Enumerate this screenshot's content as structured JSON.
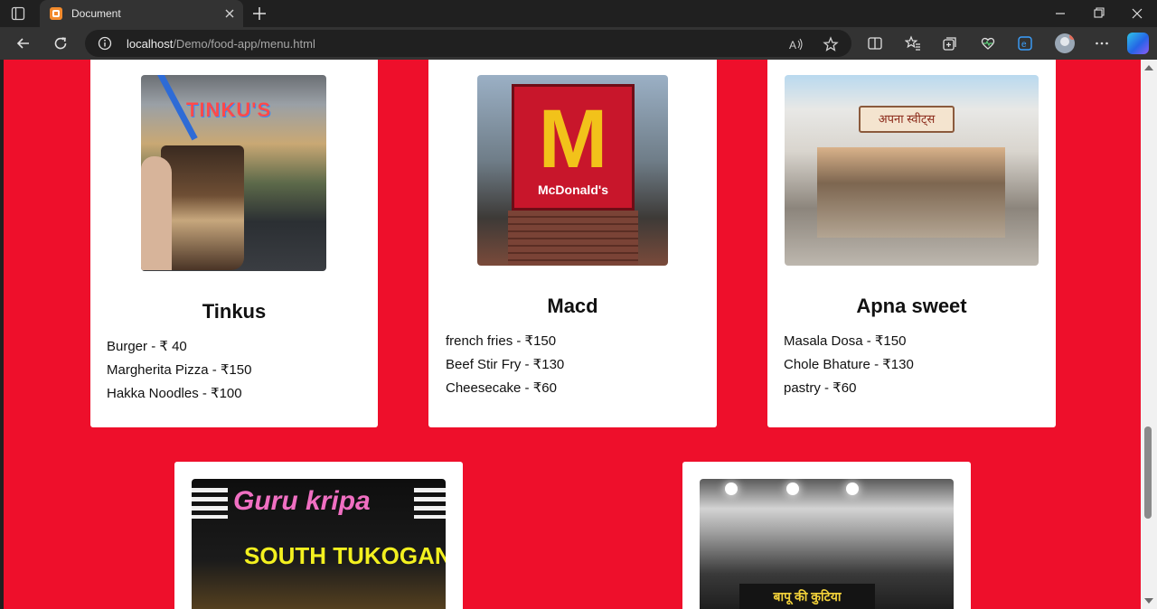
{
  "browser": {
    "tab_title": "Document",
    "url_host": "localhost",
    "url_path": "/Demo/food-app/menu.html"
  },
  "colors": {
    "page_background": "#ee0f2b",
    "card_background": "#ffffff"
  },
  "restaurants": [
    {
      "name": "Tinkus",
      "photo_sign": "TINKU'S",
      "menu": [
        "Burger - ₹ 40",
        "Margherita Pizza - ₹150",
        "Hakka Noodles - ₹100"
      ]
    },
    {
      "name": "Macd",
      "photo_sign": "McDonald's",
      "menu": [
        "french fries - ₹150",
        "Beef Stir Fry - ₹130",
        "Cheesecake - ₹60"
      ]
    },
    {
      "name": "Apna sweet",
      "photo_sign": "अपना स्वीट्स",
      "menu": [
        "Masala Dosa - ₹150",
        "Chole Bhature - ₹130",
        "pastry - ₹60"
      ]
    },
    {
      "photo_sign": "Guru kripa",
      "photo_subsign": "SOUTH TUKOGANJ"
    },
    {
      "photo_sign": "बापू की कुटिया"
    }
  ]
}
